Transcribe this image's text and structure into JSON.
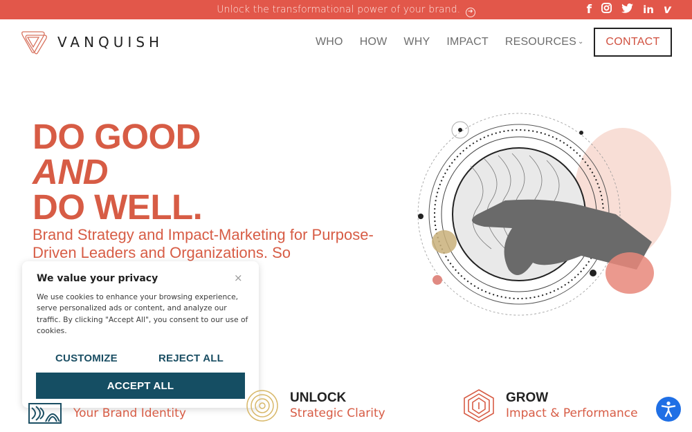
{
  "announcement": {
    "text": "Unlock the transformational power of your brand.",
    "icon": "arrow-right-circle-icon"
  },
  "social": [
    {
      "name": "facebook-icon",
      "glyph": "f"
    },
    {
      "name": "instagram-icon",
      "glyph": "◎"
    },
    {
      "name": "twitter-icon",
      "glyph": "🐦"
    },
    {
      "name": "linkedin-icon",
      "glyph": "in"
    },
    {
      "name": "vimeo-icon",
      "glyph": "v"
    }
  ],
  "brand": {
    "name": "VANQUISH",
    "accent": "#e2574a",
    "dark_teal": "#154e63"
  },
  "nav": {
    "items": [
      "WHO",
      "HOW",
      "WHY",
      "IMPACT",
      "RESOURCES"
    ],
    "resources_chevron": "⌄",
    "contact": "CONTACT"
  },
  "hero": {
    "line1": "DO GOOD",
    "line2": "AND",
    "line3": "DO WELL.",
    "subtitle": "Brand Strategy and Impact-Marketing for Purpose-Driven Leaders and Organizations. So"
  },
  "cookie": {
    "title": "We value your privacy",
    "close": "×",
    "body": "We use cookies to enhance your browsing experience, serve personalized ads or content, and analyze our traffic. By clicking \"Accept All\", you consent to our use of cookies.",
    "customize": "CUSTOMIZE",
    "reject": "REJECT ALL",
    "accept": "ACCEPT ALL"
  },
  "features": [
    {
      "title": "",
      "subtitle": "Your Brand Identity"
    },
    {
      "title": "UNLOCK",
      "subtitle": "Strategic Clarity"
    },
    {
      "title": "GROW",
      "subtitle": "Impact & Performance"
    }
  ],
  "accessibility": {
    "icon": "accessibility-icon"
  }
}
